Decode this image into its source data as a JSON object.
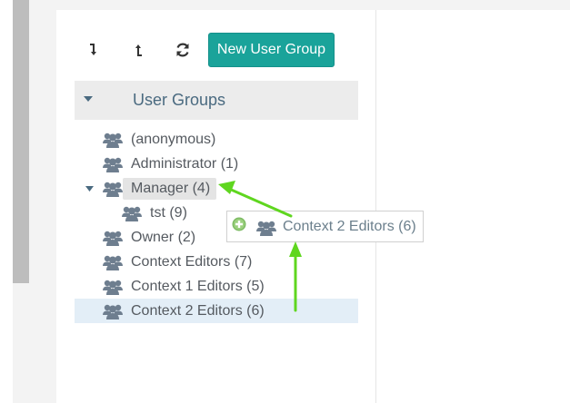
{
  "toolbar": {
    "expand_icon": "arrow-down-icon",
    "collapse_icon": "arrow-up-icon",
    "refresh_icon": "refresh-icon",
    "new_group_label": "New User Group"
  },
  "tree": {
    "header_label": "User Groups",
    "items": [
      {
        "label": "(anonymous)",
        "level": 0
      },
      {
        "label": "Administrator (1)",
        "level": 0
      },
      {
        "label": "Manager (4)",
        "level": 0,
        "expanded": true,
        "drop_target": true
      },
      {
        "label": "tst (9)",
        "level": 1
      },
      {
        "label": "Owner (2)",
        "level": 0
      },
      {
        "label": "Context Editors (7)",
        "level": 0
      },
      {
        "label": "Context 1 Editors (5)",
        "level": 0
      },
      {
        "label": "Context 2 Editors (6)",
        "level": 0,
        "selected": true
      }
    ]
  },
  "drag": {
    "label": "Context 2 Editors (6)",
    "icon": "add-circle-icon"
  },
  "colors": {
    "primary": "#1aa39a",
    "annotation": "#5fd61f",
    "selected_row": "#e3eef7",
    "group_icon": "#6e7e8f"
  }
}
